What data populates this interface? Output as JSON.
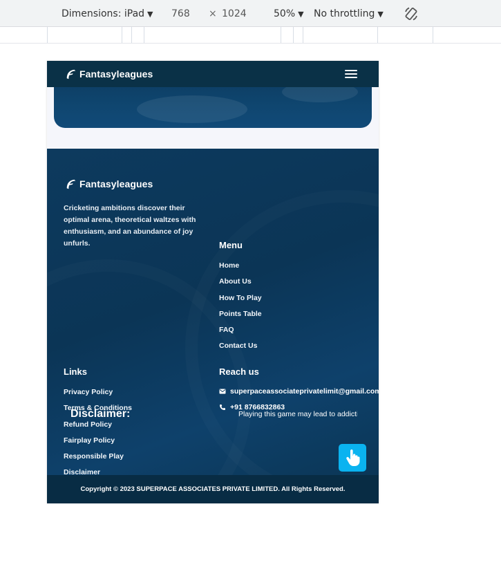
{
  "devtools": {
    "device": "Dimensions: iPad",
    "width": "768",
    "times": "×",
    "height": "1024",
    "zoom": "50%",
    "throttling": "No throttling",
    "caret": "▼"
  },
  "site": {
    "brand": "Fantasyleagues",
    "footer": {
      "about": "Cricketing ambitions discover their optimal arena, theoretical waltzes with enthusiasm, and an abundance of joy unfurls.",
      "menu_title": "Menu",
      "menu": [
        "Home",
        "About Us",
        "How To Play",
        "Points Table",
        "FAQ",
        "Contact Us"
      ],
      "links_title": "Links",
      "links": [
        "Privacy Policy",
        "Terms & Conditions",
        "Refund Policy",
        "Fairplay Policy",
        "Responsible Play",
        "Disclaimer"
      ],
      "reach_title": "Reach us",
      "email": "superpaceassociateprivatelimit@gmail.com",
      "phone": "+91 8766832863"
    },
    "disclaimer_title": "Disclaimer:",
    "disclaimer_text": "Playing this game may lead to addiction",
    "copyright": "Copyright © 2023 SUPERPACE ASSOCIATES PRIVATE LIMITED.  All Rights Reserved."
  },
  "colors": {
    "header": "#0a3147",
    "footer": "#0d3a5e",
    "copyright": "#082c44",
    "help_button": "#0ab3f0"
  },
  "icons": [
    "logo-icon",
    "menu-icon",
    "email-icon",
    "phone-icon",
    "hand-pointer-icon",
    "rotate-icon"
  ]
}
